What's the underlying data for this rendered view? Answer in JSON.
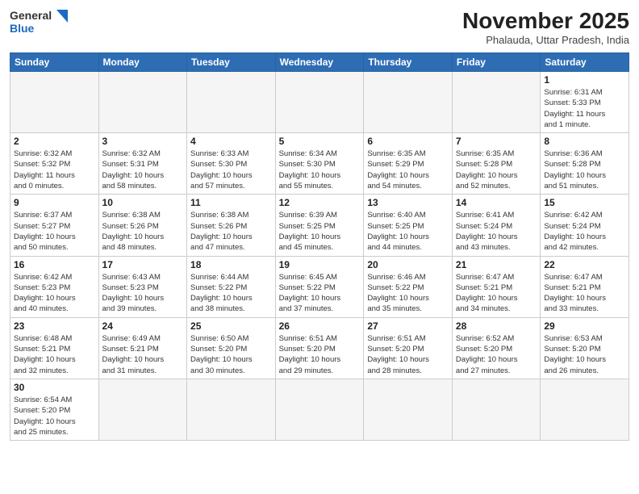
{
  "logo": {
    "line1": "General",
    "line2": "Blue"
  },
  "title": "November 2025",
  "subtitle": "Phalauda, Uttar Pradesh, India",
  "weekdays": [
    "Sunday",
    "Monday",
    "Tuesday",
    "Wednesday",
    "Thursday",
    "Friday",
    "Saturday"
  ],
  "weeks": [
    [
      {
        "day": "",
        "info": ""
      },
      {
        "day": "",
        "info": ""
      },
      {
        "day": "",
        "info": ""
      },
      {
        "day": "",
        "info": ""
      },
      {
        "day": "",
        "info": ""
      },
      {
        "day": "",
        "info": ""
      },
      {
        "day": "1",
        "info": "Sunrise: 6:31 AM\nSunset: 5:33 PM\nDaylight: 11 hours\nand 1 minute."
      }
    ],
    [
      {
        "day": "2",
        "info": "Sunrise: 6:32 AM\nSunset: 5:32 PM\nDaylight: 11 hours\nand 0 minutes."
      },
      {
        "day": "3",
        "info": "Sunrise: 6:32 AM\nSunset: 5:31 PM\nDaylight: 10 hours\nand 58 minutes."
      },
      {
        "day": "4",
        "info": "Sunrise: 6:33 AM\nSunset: 5:30 PM\nDaylight: 10 hours\nand 57 minutes."
      },
      {
        "day": "5",
        "info": "Sunrise: 6:34 AM\nSunset: 5:30 PM\nDaylight: 10 hours\nand 55 minutes."
      },
      {
        "day": "6",
        "info": "Sunrise: 6:35 AM\nSunset: 5:29 PM\nDaylight: 10 hours\nand 54 minutes."
      },
      {
        "day": "7",
        "info": "Sunrise: 6:35 AM\nSunset: 5:28 PM\nDaylight: 10 hours\nand 52 minutes."
      },
      {
        "day": "8",
        "info": "Sunrise: 6:36 AM\nSunset: 5:28 PM\nDaylight: 10 hours\nand 51 minutes."
      }
    ],
    [
      {
        "day": "9",
        "info": "Sunrise: 6:37 AM\nSunset: 5:27 PM\nDaylight: 10 hours\nand 50 minutes."
      },
      {
        "day": "10",
        "info": "Sunrise: 6:38 AM\nSunset: 5:26 PM\nDaylight: 10 hours\nand 48 minutes."
      },
      {
        "day": "11",
        "info": "Sunrise: 6:38 AM\nSunset: 5:26 PM\nDaylight: 10 hours\nand 47 minutes."
      },
      {
        "day": "12",
        "info": "Sunrise: 6:39 AM\nSunset: 5:25 PM\nDaylight: 10 hours\nand 45 minutes."
      },
      {
        "day": "13",
        "info": "Sunrise: 6:40 AM\nSunset: 5:25 PM\nDaylight: 10 hours\nand 44 minutes."
      },
      {
        "day": "14",
        "info": "Sunrise: 6:41 AM\nSunset: 5:24 PM\nDaylight: 10 hours\nand 43 minutes."
      },
      {
        "day": "15",
        "info": "Sunrise: 6:42 AM\nSunset: 5:24 PM\nDaylight: 10 hours\nand 42 minutes."
      }
    ],
    [
      {
        "day": "16",
        "info": "Sunrise: 6:42 AM\nSunset: 5:23 PM\nDaylight: 10 hours\nand 40 minutes."
      },
      {
        "day": "17",
        "info": "Sunrise: 6:43 AM\nSunset: 5:23 PM\nDaylight: 10 hours\nand 39 minutes."
      },
      {
        "day": "18",
        "info": "Sunrise: 6:44 AM\nSunset: 5:22 PM\nDaylight: 10 hours\nand 38 minutes."
      },
      {
        "day": "19",
        "info": "Sunrise: 6:45 AM\nSunset: 5:22 PM\nDaylight: 10 hours\nand 37 minutes."
      },
      {
        "day": "20",
        "info": "Sunrise: 6:46 AM\nSunset: 5:22 PM\nDaylight: 10 hours\nand 35 minutes."
      },
      {
        "day": "21",
        "info": "Sunrise: 6:47 AM\nSunset: 5:21 PM\nDaylight: 10 hours\nand 34 minutes."
      },
      {
        "day": "22",
        "info": "Sunrise: 6:47 AM\nSunset: 5:21 PM\nDaylight: 10 hours\nand 33 minutes."
      }
    ],
    [
      {
        "day": "23",
        "info": "Sunrise: 6:48 AM\nSunset: 5:21 PM\nDaylight: 10 hours\nand 32 minutes."
      },
      {
        "day": "24",
        "info": "Sunrise: 6:49 AM\nSunset: 5:21 PM\nDaylight: 10 hours\nand 31 minutes."
      },
      {
        "day": "25",
        "info": "Sunrise: 6:50 AM\nSunset: 5:20 PM\nDaylight: 10 hours\nand 30 minutes."
      },
      {
        "day": "26",
        "info": "Sunrise: 6:51 AM\nSunset: 5:20 PM\nDaylight: 10 hours\nand 29 minutes."
      },
      {
        "day": "27",
        "info": "Sunrise: 6:51 AM\nSunset: 5:20 PM\nDaylight: 10 hours\nand 28 minutes."
      },
      {
        "day": "28",
        "info": "Sunrise: 6:52 AM\nSunset: 5:20 PM\nDaylight: 10 hours\nand 27 minutes."
      },
      {
        "day": "29",
        "info": "Sunrise: 6:53 AM\nSunset: 5:20 PM\nDaylight: 10 hours\nand 26 minutes."
      }
    ],
    [
      {
        "day": "30",
        "info": "Sunrise: 6:54 AM\nSunset: 5:20 PM\nDaylight: 10 hours\nand 25 minutes."
      },
      {
        "day": "",
        "info": ""
      },
      {
        "day": "",
        "info": ""
      },
      {
        "day": "",
        "info": ""
      },
      {
        "day": "",
        "info": ""
      },
      {
        "day": "",
        "info": ""
      },
      {
        "day": "",
        "info": ""
      }
    ]
  ]
}
